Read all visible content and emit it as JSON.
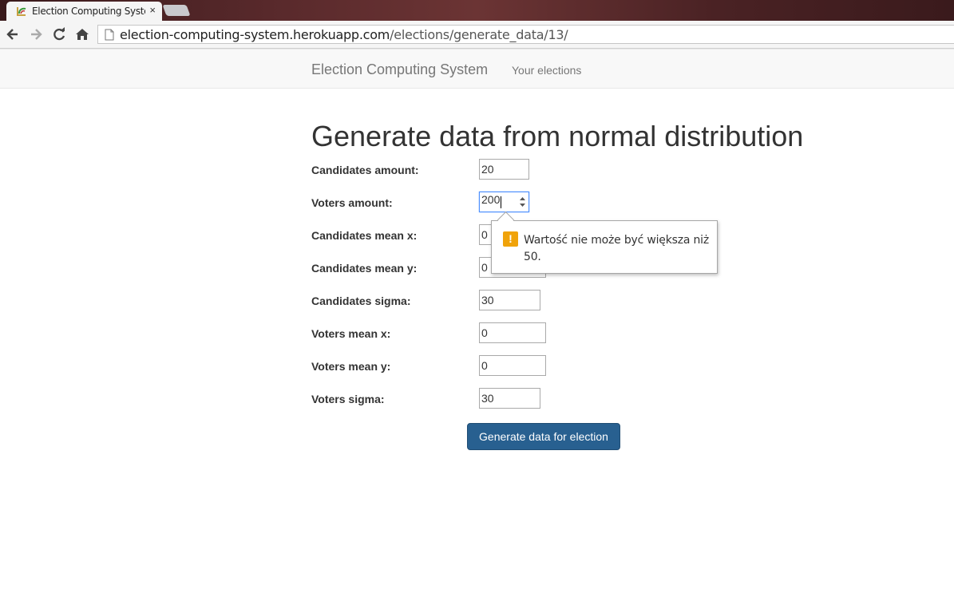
{
  "browser": {
    "tab_title": "Election Computing System",
    "tab_close": "×",
    "url_host": "election-computing-system.herokuapp.com",
    "url_path": "/elections/generate_data/13/"
  },
  "navbar": {
    "brand": "Election Computing System",
    "link_your_elections": "Your elections"
  },
  "main": {
    "title": "Generate data from normal distribution",
    "fields": [
      {
        "label": "Candidates amount:",
        "value": "20"
      },
      {
        "label": "Voters amount:",
        "value": "200"
      },
      {
        "label": "Candidates mean x:",
        "value": "0"
      },
      {
        "label": "Candidates mean y:",
        "value": "0"
      },
      {
        "label": "Candidates sigma:",
        "value": "30"
      },
      {
        "label": "Voters mean x:",
        "value": "0"
      },
      {
        "label": "Voters mean y:",
        "value": "0"
      },
      {
        "label": "Voters sigma:",
        "value": "30"
      }
    ],
    "submit_label": "Generate data for election"
  },
  "validation": {
    "icon": "!",
    "message": "Wartość nie może być większa niż 50."
  },
  "colors": {
    "primary_button": "#286090",
    "warning_icon": "#f0a30a"
  }
}
